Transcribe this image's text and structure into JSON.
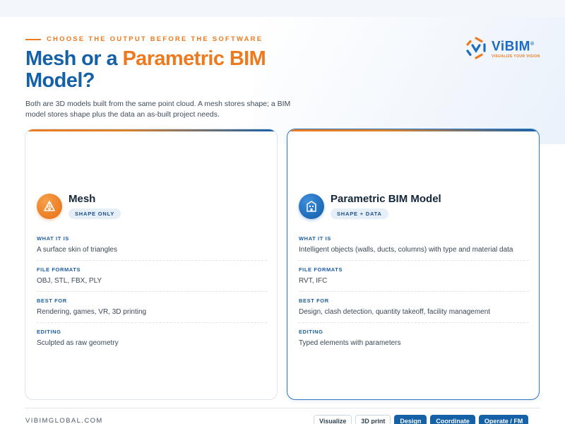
{
  "header": {
    "kicker": "CHOOSE THE OUTPUT BEFORE THE SOFTWARE",
    "title_part1": "Mesh or a ",
    "title_part2": "Parametric BIM",
    "title_part3": "Model?",
    "intro": "Both are 3D models built from the same point cloud. A mesh stores shape; a BIM model stores shape plus the data an as-built project needs."
  },
  "logo": {
    "word": "ViBIM",
    "mark": "®",
    "tagline": "VISUALIZE YOUR VISION",
    "icon": "vibim-hexagon-logo"
  },
  "colors": {
    "accent_orange": "#ee7a1f",
    "accent_blue": "#1561a8"
  },
  "cards": [
    {
      "title": "Mesh",
      "badge": "SHAPE ONLY",
      "icon": "mesh-triangle-icon",
      "rows": [
        {
          "label": "WHAT IT IS",
          "value": "A surface skin of triangles"
        },
        {
          "label": "FILE FORMATS",
          "value": "OBJ, STL, FBX, PLY"
        },
        {
          "label": "BEST FOR",
          "value": "Rendering, games, VR, 3D printing"
        },
        {
          "label": "EDITING",
          "value": "Sculpted as raw geometry"
        }
      ]
    },
    {
      "title": "Parametric BIM Model",
      "badge": "SHAPE + DATA",
      "icon": "building-icon",
      "rows": [
        {
          "label": "WHAT IT IS",
          "value": "Intelligent objects (walls, ducts, columns) with type and material data"
        },
        {
          "label": "FILE FORMATS",
          "value": "RVT, IFC"
        },
        {
          "label": "BEST FOR",
          "value": "Design, clash detection, quantity takeoff, facility management"
        },
        {
          "label": "EDITING",
          "value": "Typed elements with parameters"
        }
      ]
    }
  ],
  "footer": {
    "brand": "VIBIMGLOBAL.COM",
    "stages": [
      {
        "label": "Visualize",
        "active": false
      },
      {
        "label": "3D print",
        "active": false
      },
      {
        "label": "Design",
        "active": true
      },
      {
        "label": "Coordinate",
        "active": true
      },
      {
        "label": "Operate / FM",
        "active": true
      }
    ]
  }
}
